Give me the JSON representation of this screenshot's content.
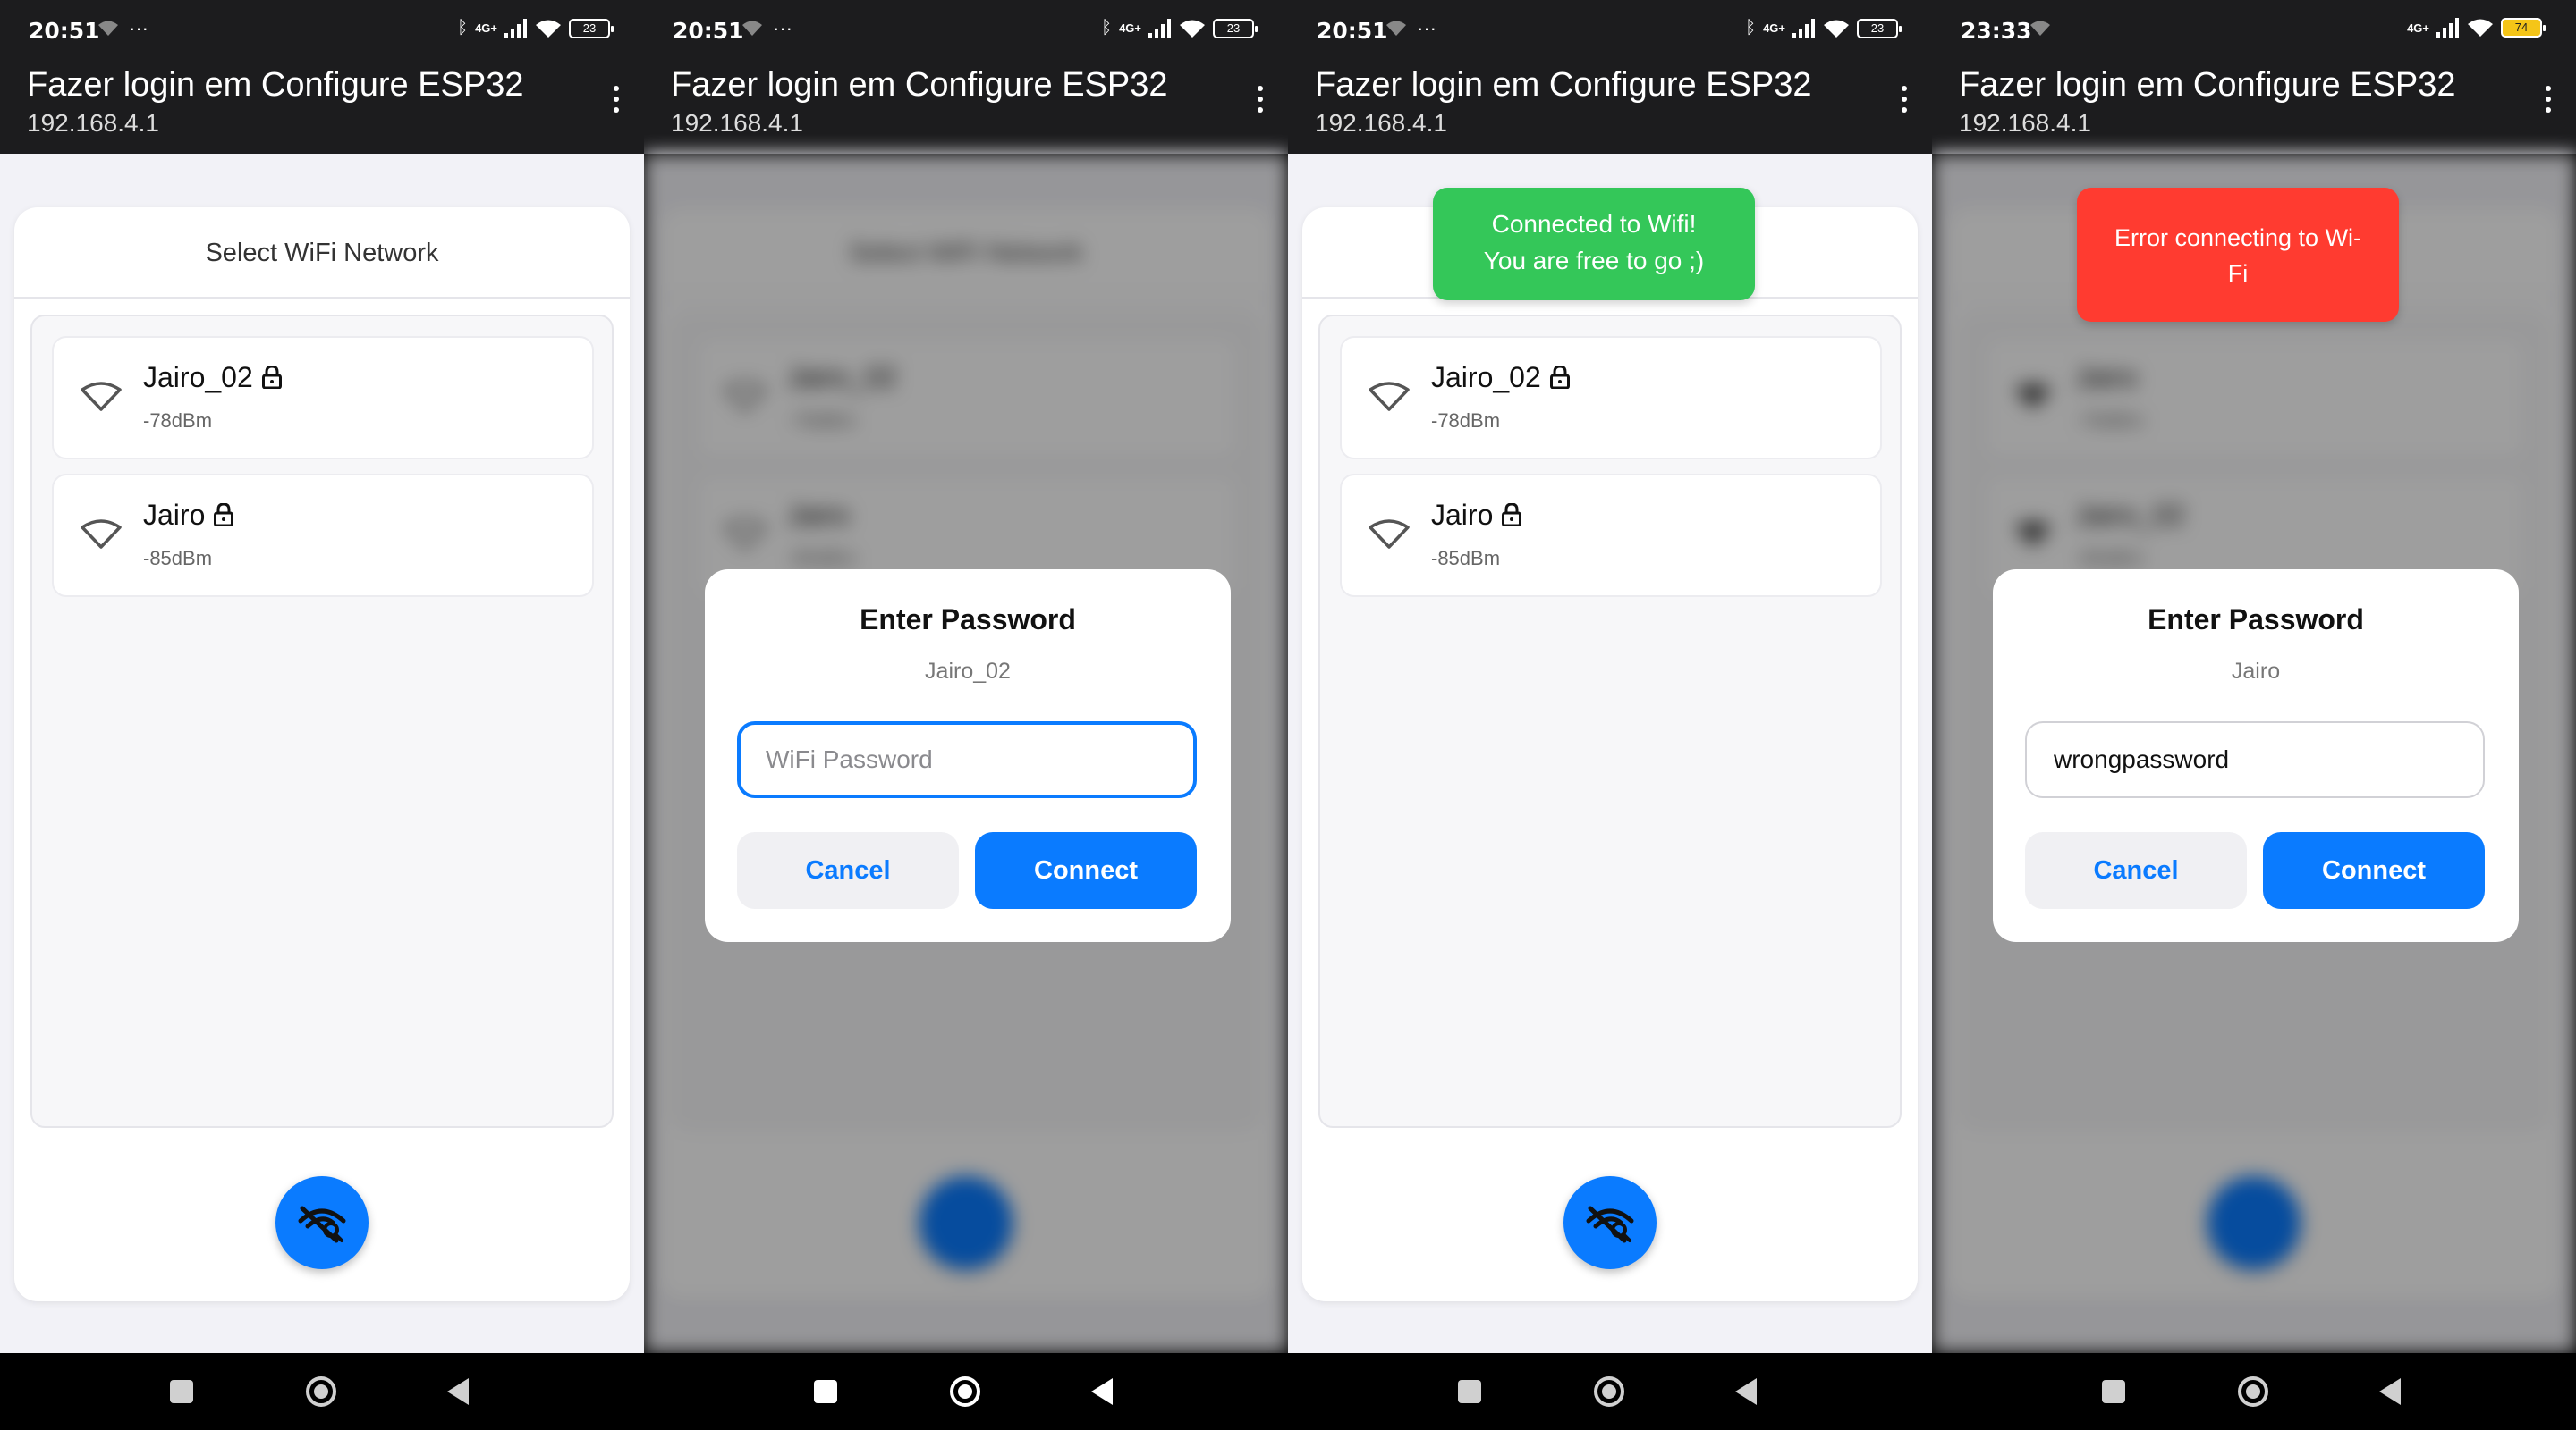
{
  "status_bar": [
    {
      "time": "20:51",
      "net": "4G+",
      "battery": "23"
    },
    {
      "time": "20:51",
      "net": "4G+",
      "battery": "23"
    },
    {
      "time": "20:51",
      "net": "4G+",
      "battery": "23"
    },
    {
      "time": "23:33",
      "net": "4G+",
      "battery": "74"
    }
  ],
  "browser": {
    "title": "Fazer login em Configure ESP32",
    "address": "192.168.4.1"
  },
  "card_title": "Select WiFi Network",
  "networks": [
    {
      "name": "Jairo_02",
      "rssi": "-78dBm"
    },
    {
      "name": "Jairo",
      "rssi": "-85dBm"
    }
  ],
  "screen2_networks": [
    {
      "name": "Jairo_02",
      "rssi": "-78dBm"
    },
    {
      "name": "Jairo",
      "rssi": "-85dBm"
    }
  ],
  "screen4_networks": [
    {
      "name": "Jairo",
      "rssi": "-78dBm"
    },
    {
      "name": "Jairo_02",
      "rssi": "-85dBm"
    }
  ],
  "modal": {
    "title": "Enter Password",
    "placeholder": "WiFi Password",
    "cancel_label": "Cancel",
    "connect_label": "Connect"
  },
  "modal_screen2": {
    "network": "Jairo_02",
    "value": ""
  },
  "modal_screen4": {
    "network": "Jairo",
    "value": "wrongpassword"
  },
  "toast_success": {
    "line1": "Connected to Wifi!",
    "line2": "You are free to go ;)"
  },
  "toast_error": {
    "line1": "Error connecting to Wi-",
    "line2": "Fi"
  },
  "icons": {
    "wifi": "wifi-icon",
    "lock": "lock-icon",
    "scan": "wifi-search-icon",
    "menu": "more-vert-icon"
  },
  "colors": {
    "accent": "#0a7bff",
    "success": "#34c759",
    "error": "#ff3b30",
    "appbar": "#1c1c1e"
  }
}
